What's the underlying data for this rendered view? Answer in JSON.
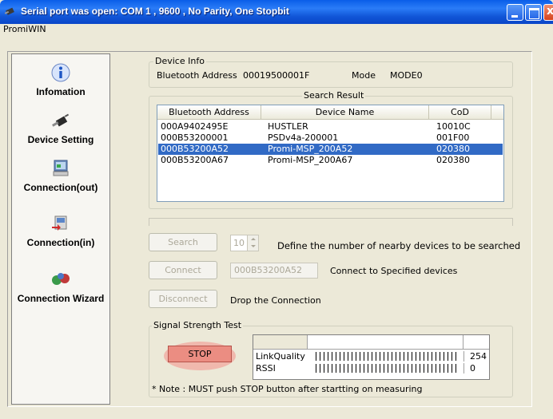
{
  "window": {
    "title": "Serial port was open: COM 1 , 9600 , No Parity, One Stopbit",
    "menu_app": "PromiWIN"
  },
  "sidebar": {
    "items": [
      {
        "label": "Infomation",
        "icon": "info-icon"
      },
      {
        "label": "Device Setting",
        "icon": "serial-cable-icon"
      },
      {
        "label": "Connection(out)",
        "icon": "computer-connection-icon"
      },
      {
        "label": "Connection(in)",
        "icon": "incoming-connection-icon"
      },
      {
        "label": "Connection Wizard",
        "icon": "wizard-icon"
      }
    ],
    "selected": "Connection(out)"
  },
  "device_info": {
    "group_title": "Device Info",
    "bt_label": "Bluetooth Address",
    "bt_value": "00019500001F",
    "mode_label": "Mode",
    "mode_value": "MODE0"
  },
  "search_result": {
    "group_title": "Search Result",
    "columns": [
      "Bluetooth Address",
      "Device Name",
      "CoD"
    ],
    "rows": [
      {
        "addr": "000A9402495E",
        "name": "HUSTLER",
        "cod": "10010C"
      },
      {
        "addr": "000B53200001",
        "name": "PSDv4a-200001",
        "cod": "001F00"
      },
      {
        "addr": "000B53200A52",
        "name": "Promi-MSP_200A52",
        "cod": "020380"
      },
      {
        "addr": "000B53200A67",
        "name": "Promi-MSP_200A67",
        "cod": "020380"
      }
    ],
    "selected_row": 2
  },
  "controls": {
    "search_label": "Search",
    "search_count": "10",
    "search_desc": "Define the number of nearby devices to be searched",
    "connect_label": "Connect",
    "connect_addr": "000B53200A52",
    "connect_desc": "Connect to Specified devices",
    "disconnect_label": "Disconnect",
    "disconnect_desc": "Drop the Connection"
  },
  "signal": {
    "group_title": "Signal Strength Test",
    "stop_label": "STOP",
    "link_quality_label": "LinkQuality",
    "link_quality_value": "254",
    "link_quality_level": 0.996,
    "rssi_label": "RSSI",
    "rssi_value": "0",
    "rssi_level": 0.996,
    "note": "* Note : MUST push STOP button after startting on measuring"
  },
  "colors": {
    "titlebar": "#0a5ee8",
    "selection": "#316ac5",
    "stop": "#eb8d82"
  }
}
